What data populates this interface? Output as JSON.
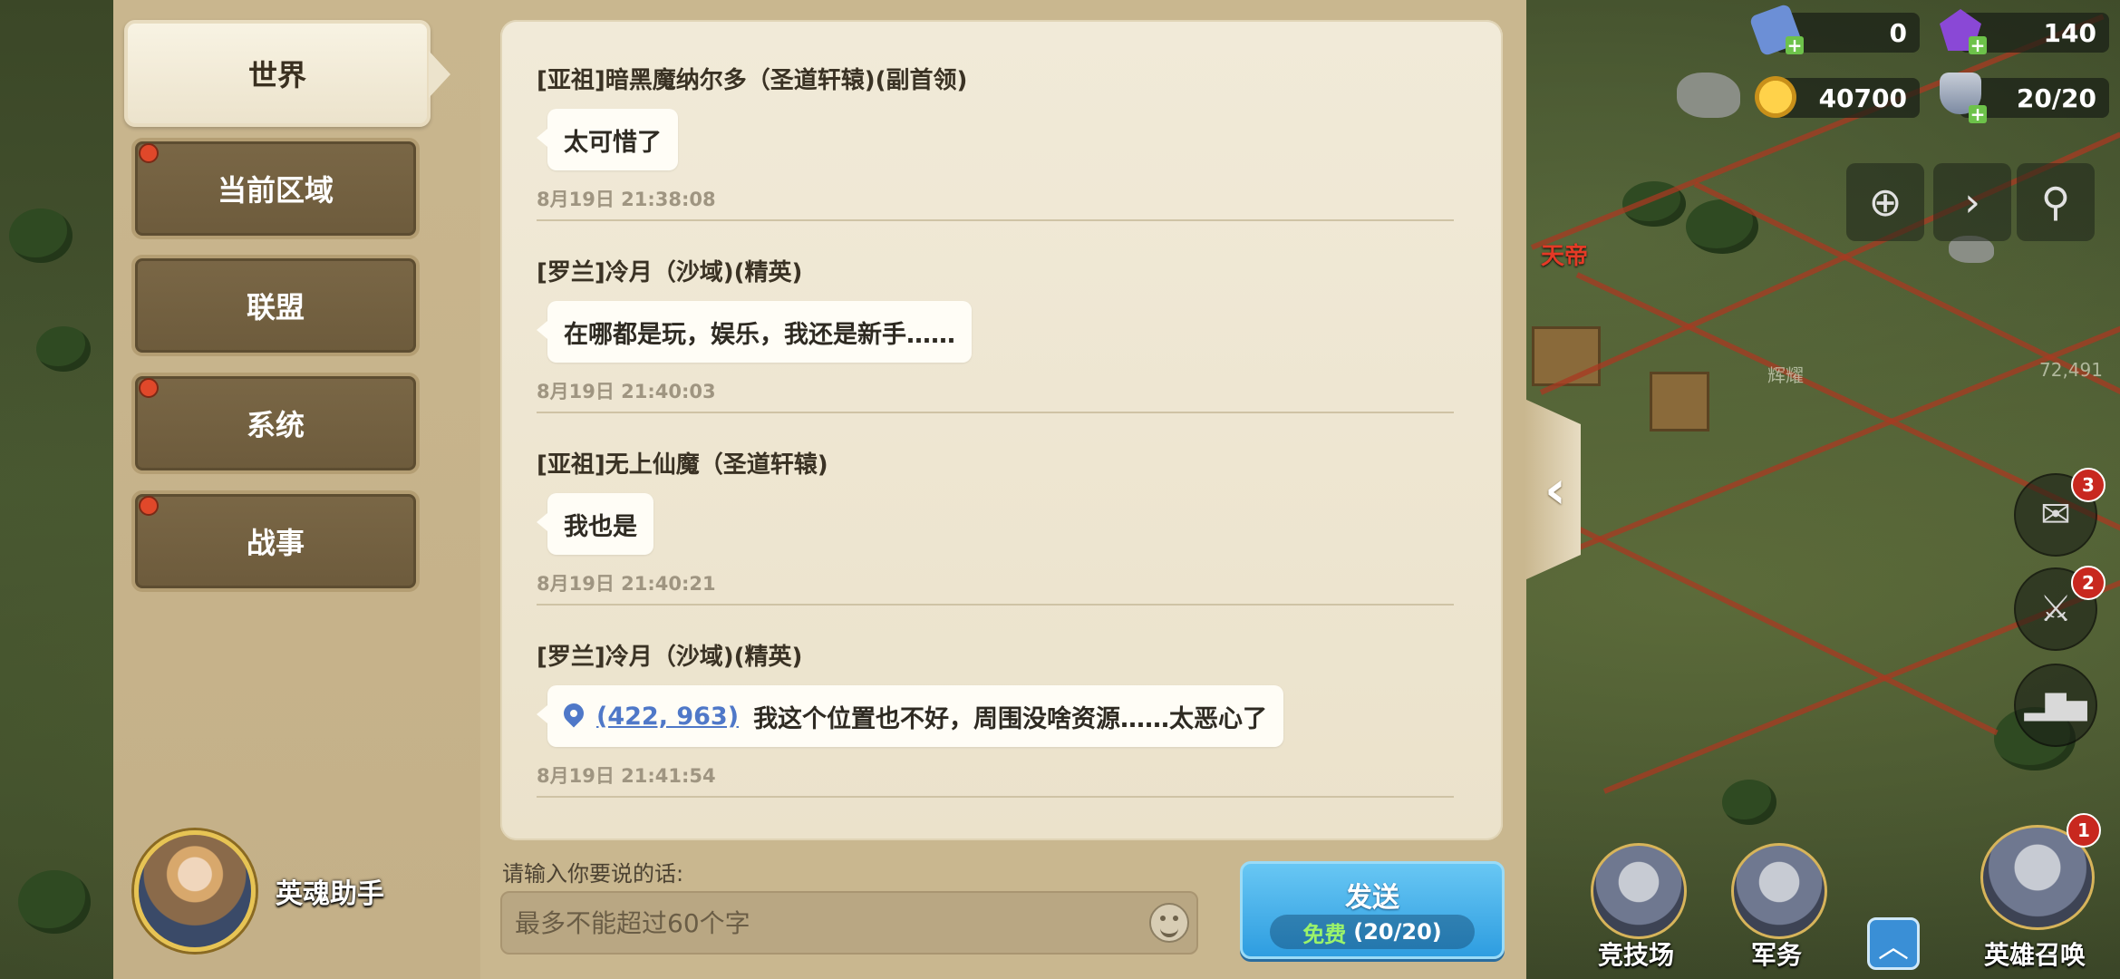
{
  "tabs": [
    {
      "label": "世界",
      "active": true,
      "dot": false
    },
    {
      "label": "当前区域",
      "active": false,
      "dot": true
    },
    {
      "label": "联盟",
      "active": false,
      "dot": false
    },
    {
      "label": "系统",
      "active": false,
      "dot": true
    },
    {
      "label": "战事",
      "active": false,
      "dot": true
    }
  ],
  "helper": {
    "label": "英魂助手"
  },
  "messages": [
    {
      "sender": "[亚祖]暗黑魔纳尔多（圣道轩辕)(副首领)",
      "text": "太可惜了",
      "time": "8月19日 21:38:08"
    },
    {
      "sender": "[罗兰]冷月（沙域)(精英)",
      "text": "在哪都是玩，娱乐，我还是新手……",
      "time": "8月19日 21:40:03"
    },
    {
      "sender": "[亚祖]无上仙魔（圣道轩辕)",
      "text": "我也是",
      "time": "8月19日 21:40:21"
    },
    {
      "sender": "[罗兰]冷月（沙域)(精英)",
      "coord": "(422, 963)",
      "text": "我这个位置也不好，周围没啥资源……太恶心了",
      "time": "8月19日 21:41:54"
    }
  ],
  "input": {
    "label": "请输入你要说的话:",
    "placeholder": "最多不能超过60个字"
  },
  "send": {
    "label": "发送",
    "free": "免费",
    "count": "(20/20)"
  },
  "resources": {
    "scroll": "0",
    "gem": "140",
    "gold": "40700",
    "troops": "20/20"
  },
  "map": {
    "player_tag": "天帝",
    "label_1": "辉耀",
    "distance": "72,491"
  },
  "side_badges": {
    "mail": "3",
    "battle": "2",
    "hero": "1"
  },
  "bottom_buttons": {
    "arena": "竞技场",
    "military": "军务",
    "hero_summon": "英雄召唤"
  },
  "colors": {
    "accent": "#2e9de0",
    "free_green": "#9bf36a",
    "badge_red": "#c8281f"
  }
}
